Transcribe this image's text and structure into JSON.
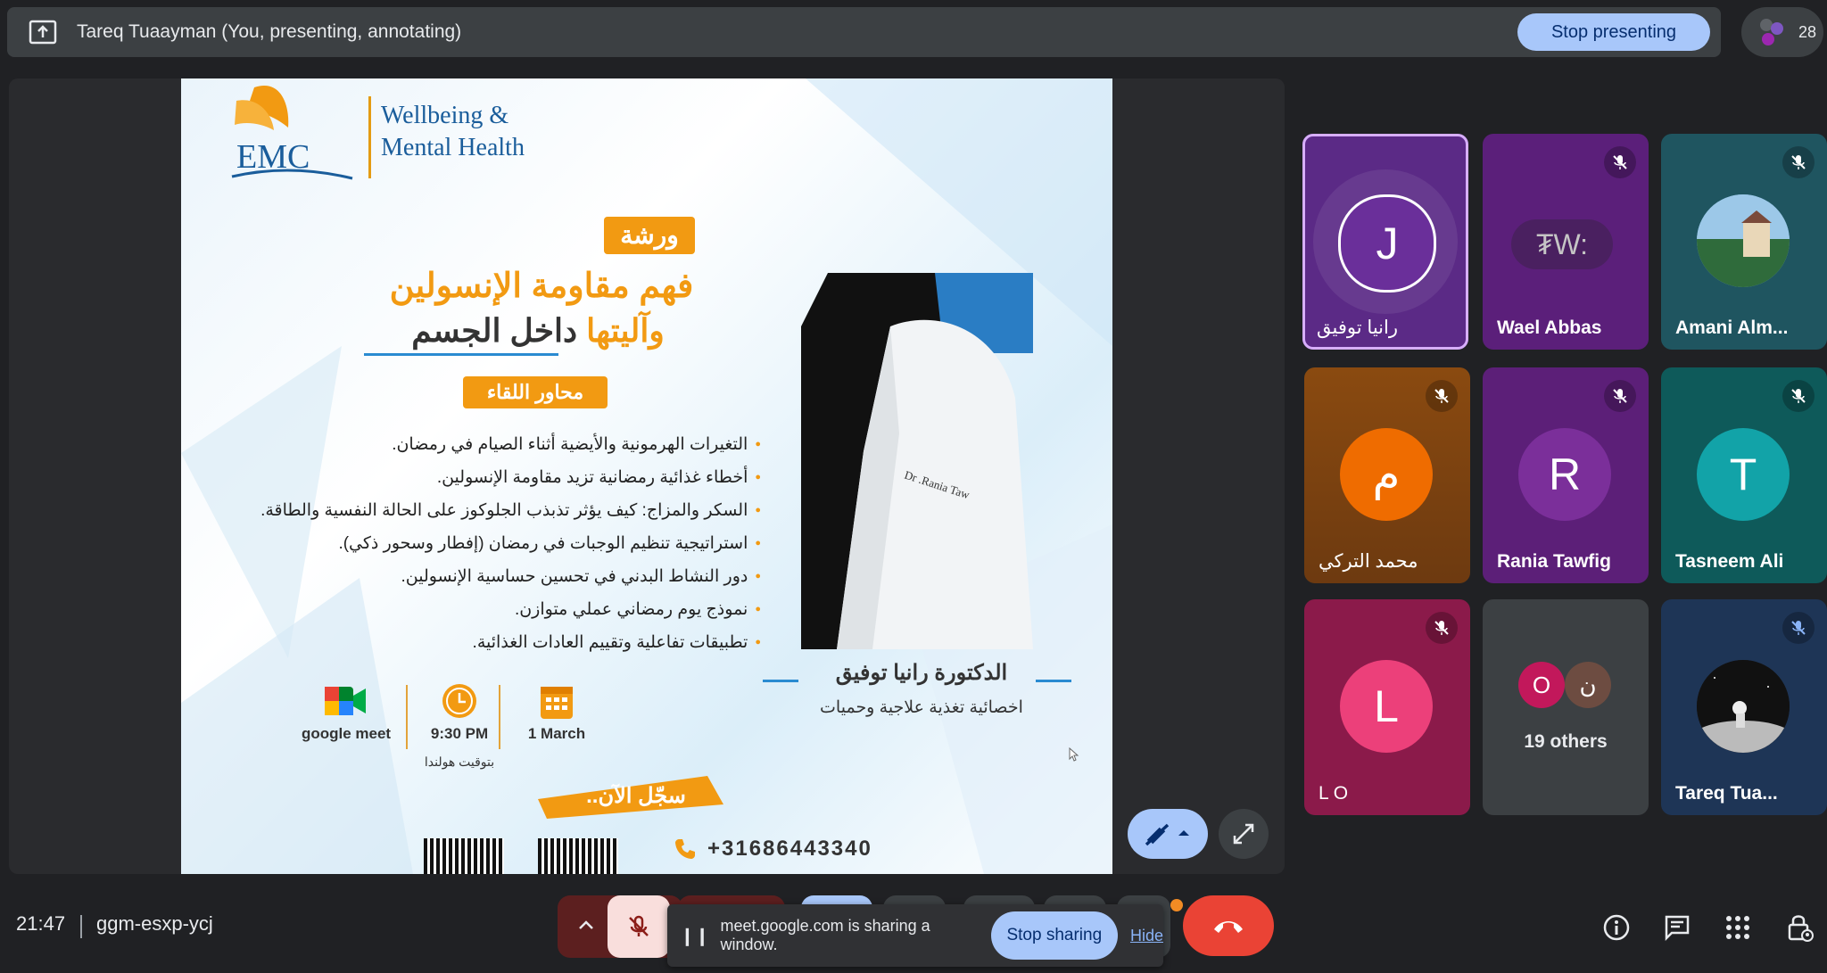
{
  "topbar": {
    "presenter_label": "Tareq Tuaayman (You, presenting, annotating)",
    "stop_presenting_label": "Stop presenting",
    "participant_count": "28"
  },
  "slide": {
    "brand_line1": "Wellbeing &",
    "brand_line2": "Mental Health",
    "logo_text": "EMC",
    "workshop_label": "ورشة",
    "title_line1": "فهم مقاومة الإنسولين",
    "title_line2_highlight": "وآليتها",
    "title_line2_rest": "داخل الجسم",
    "topics_label": "محاور اللقاء",
    "bullets": [
      "التغيرات الهرمونية والأيضية أثناء الصيام في رمضان.",
      "أخطاء غذائية رمضانية تزيد مقاومة الإنسولين.",
      "السكر والمزاج: كيف يؤثر تذبذب الجلوكوز على الحالة النفسية والطاقة.",
      "استراتيجية تنظيم الوجبات في رمضان (إفطار وسحور ذكي).",
      "دور النشاط البدني في تحسين حساسية الإنسولين.",
      "نموذج يوم رمضاني عملي متوازن.",
      "تطبيقات تفاعلية وتقييم العادات الغذائية."
    ],
    "coat_text": "Dr .Rania Taw",
    "doctor_name": "الدكتورة رانيا توفيق",
    "doctor_title": "اخصائية تغذية علاجية وحميات",
    "platform": "google meet",
    "time": "9:30 PM",
    "time_note": "بتوقيت هولندا",
    "date": "1 March",
    "cta": "سجّل الآن..",
    "phone": "+31686443340"
  },
  "tiles": [
    {
      "name": "رانيا توفيق",
      "initial": "J",
      "color": "#5b2a86",
      "muted": false
    },
    {
      "name": "Wael Abbas",
      "initial": "₮W:",
      "color": "#5b1f7a",
      "muted": true
    },
    {
      "name": "Amani Alm...",
      "initial": "",
      "color": "#1f5560",
      "muted": true
    },
    {
      "name": "محمد التركي",
      "initial": "م",
      "color": "#8a4a10",
      "muted": true
    },
    {
      "name": "Rania Tawfig",
      "initial": "R",
      "color": "#5c1f78",
      "muted": true
    },
    {
      "name": "Tasneem Ali",
      "initial": "T",
      "color": "#0e5a5a",
      "muted": true
    },
    {
      "name": "L O",
      "initial": "L",
      "color": "#8b1a4a",
      "muted": true
    },
    {
      "name": "19 others",
      "initial": "",
      "color": "#3c4043",
      "muted": false
    },
    {
      "name": "Tareq Tua...",
      "initial": "",
      "color": "#1e3556",
      "muted": true
    }
  ],
  "others": {
    "a": "O",
    "b": "ن"
  },
  "bottombar": {
    "time": "21:47",
    "meeting_code": "ggm-esxp-ycj",
    "sharing_message": "meet.google.com is sharing a window.",
    "stop_sharing_label": "Stop sharing",
    "hide_label": "Hide"
  },
  "colors": {
    "accent": "#a8c7fa",
    "end_call": "#ea4335",
    "orange": "#f29a12"
  }
}
